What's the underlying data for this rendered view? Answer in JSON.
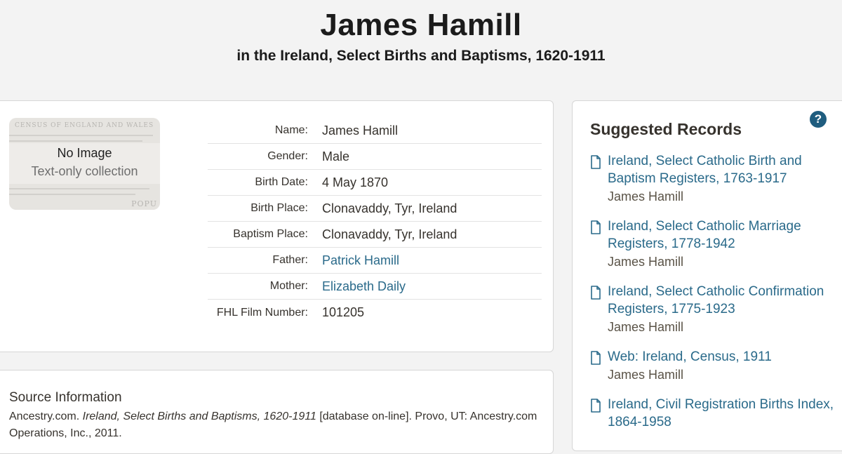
{
  "header": {
    "name": "James Hamill",
    "collection": "in the Ireland, Select Births and Baptisms, 1620-1911"
  },
  "image_placeholder": {
    "title": "No Image",
    "subtitle": "Text-only collection",
    "bg_text_top": "CENSUS OF ENGLAND AND WALES",
    "bg_text_bottom": "POPU"
  },
  "fields": [
    {
      "label": "Name:",
      "value": "James Hamill",
      "link": false
    },
    {
      "label": "Gender:",
      "value": "Male",
      "link": false
    },
    {
      "label": "Birth Date:",
      "value": "4 May 1870",
      "link": false
    },
    {
      "label": "Birth Place:",
      "value": "Clonavaddy, Tyr, Ireland",
      "link": false
    },
    {
      "label": "Baptism Place:",
      "value": "Clonavaddy, Tyr, Ireland",
      "link": false
    },
    {
      "label": "Father:",
      "value": "Patrick Hamill",
      "link": true
    },
    {
      "label": "Mother:",
      "value": "Elizabeth Daily",
      "link": true
    },
    {
      "label": "FHL Film Number:",
      "value": "101205",
      "link": false
    }
  ],
  "source": {
    "title": "Source Information",
    "publisher": "Ancestry.com.",
    "collection_italic": "Ireland, Select Births and Baptisms, 1620-1911",
    "rest": "[database on-line]. Provo, UT: Ancestry.com Operations, Inc., 2011."
  },
  "suggested": {
    "title": "Suggested Records",
    "help_icon": "question-circle-icon",
    "items": [
      {
        "link": "Ireland, Select Catholic Birth and Baptism Registers, 1763-1917",
        "name": "James Hamill"
      },
      {
        "link": "Ireland, Select Catholic Marriage Registers, 1778-1942",
        "name": "James Hamill"
      },
      {
        "link": "Ireland, Select Catholic Confirmation Registers, 1775-1923",
        "name": "James Hamill"
      },
      {
        "link": "Web: Ireland, Census, 1911",
        "name": "James Hamill"
      },
      {
        "link": "Ireland, Civil Registration Births Index, 1864-1958",
        "name": ""
      }
    ]
  },
  "colors": {
    "link": "#2a6a8a",
    "help_icon": "#1f5d7f",
    "background": "#f3f3f3"
  }
}
